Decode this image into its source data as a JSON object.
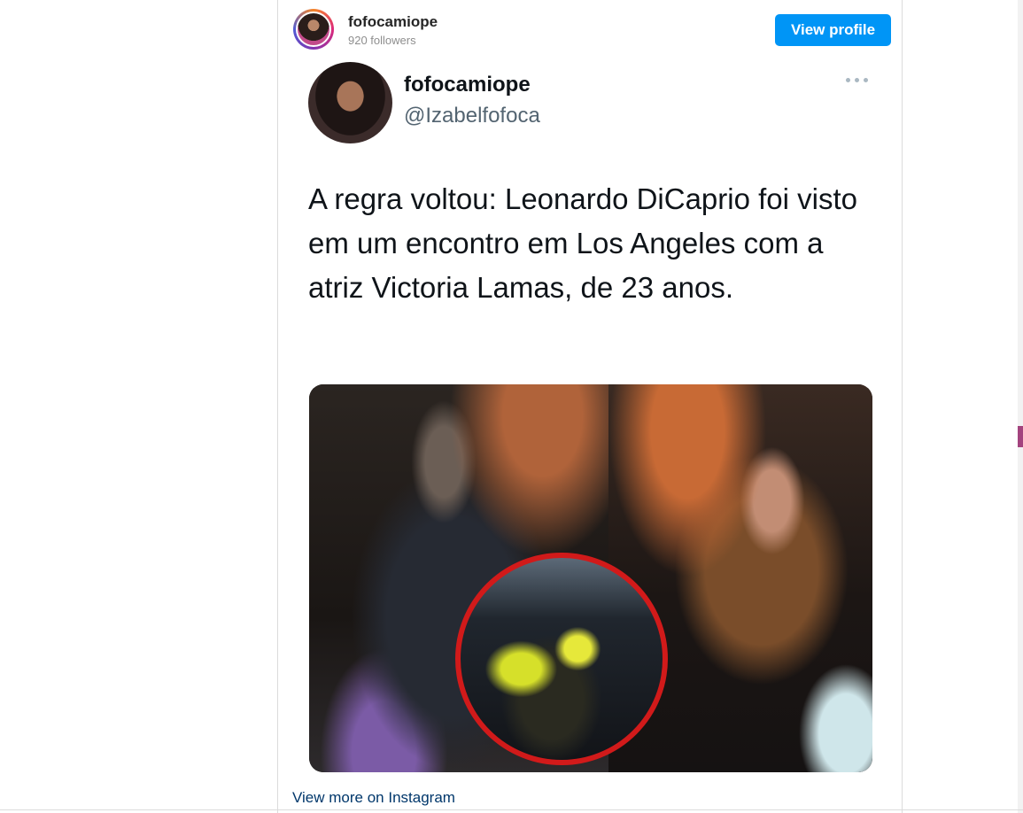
{
  "instagram": {
    "username": "fofocamiope",
    "followers": "920 followers",
    "view_profile_label": "View profile",
    "view_more_label": "View more on Instagram",
    "accent_color": "#0095f6"
  },
  "tweet": {
    "display_name": "fofocamiope",
    "handle": "@Izabelfofoca",
    "text": "A regra voltou: Leonardo DiCaprio foi visto em um encontro em Los Angeles com a atriz Victoria Lamas, de 23 anos.",
    "more_icon": "more-horizontal-icon"
  },
  "media": {
    "photos": [
      "photo-left",
      "photo-right"
    ],
    "inset_highlight_color": "#d11a1a"
  }
}
